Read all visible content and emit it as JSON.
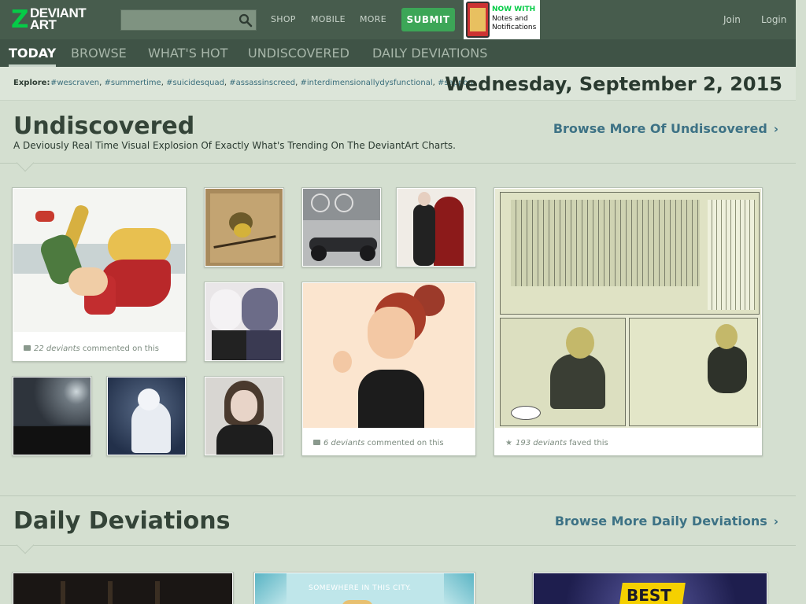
{
  "brand": {
    "logo_mark": "Z",
    "logo_text": "DEVIANT ART"
  },
  "search": {
    "placeholder": ""
  },
  "nav": {
    "shop": "SHOP",
    "mobile": "MOBILE",
    "more": "MORE",
    "submit": "SUBMIT",
    "join": "Join",
    "login": "Login"
  },
  "promo": {
    "line1": "NOW WITH",
    "line2": "Notes and Notifications"
  },
  "tabs": [
    "TODAY",
    "BROWSE",
    "WHAT'S HOT",
    "UNDISCOVERED",
    "DAILY DEVIATIONS"
  ],
  "explore": {
    "label": "Explore:",
    "tags": [
      "#wescraven",
      "#summertime",
      "#suicidesquad",
      "#assassinscreed",
      "#interdimensionallydysfunctional",
      "#sapporo"
    ]
  },
  "date": "Wednesday, September 2, 2015",
  "undiscovered": {
    "title": "Undiscovered",
    "subtitle": "A Deviously Real Time Visual Explosion Of Exactly What's Trending On The DeviantArt Charts.",
    "more": "Browse More Of Undiscovered",
    "cards": [
      {
        "count": "22 deviants",
        "text": "commented on this",
        "icon": "comment-icon"
      },
      {
        "count": "6 deviants",
        "text": "commented on this",
        "icon": "comment-icon"
      },
      {
        "count": "193 deviants",
        "text": "faved this",
        "icon": "star-icon"
      }
    ]
  },
  "daily": {
    "title": "Daily Deviations",
    "more": "Browse More Daily Deviations",
    "thumb_texts": [
      "SOMEWHERE IN THIS CITY.",
      "BEST"
    ]
  },
  "colors": {
    "accent_green": "#05cc47",
    "link_blue": "#3d7285",
    "topbar": "#475c4d",
    "background": "#d4dfd0"
  }
}
